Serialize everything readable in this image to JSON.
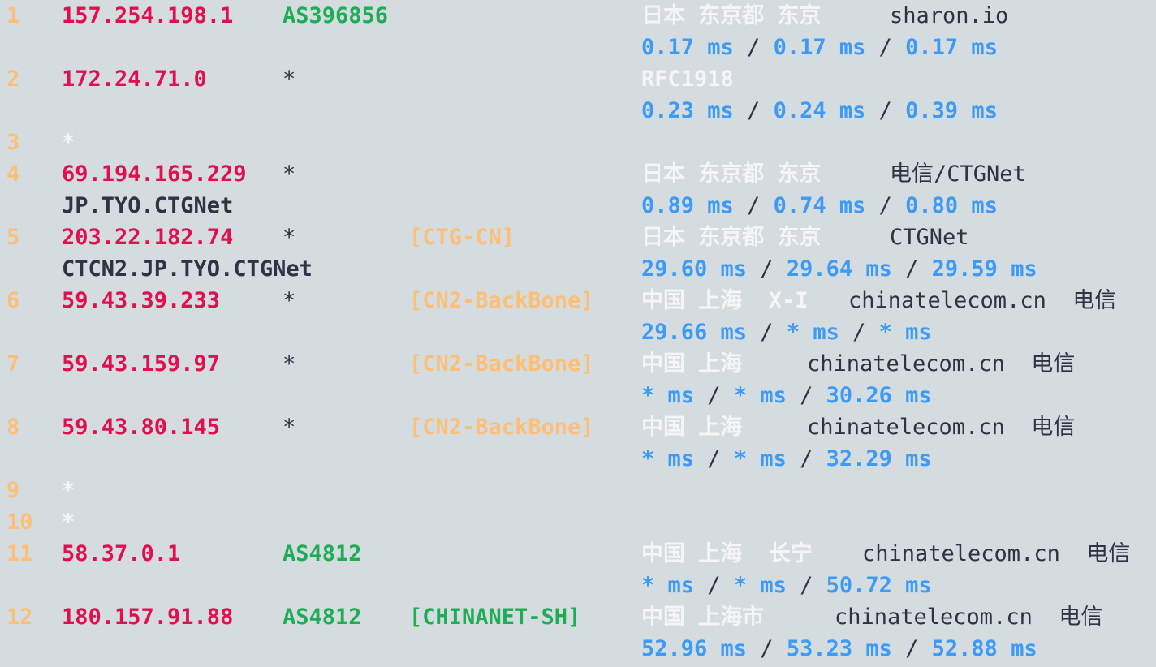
{
  "colors": {
    "background": "#d5dce0",
    "hop_number": "#fdbe76",
    "ip": "#e0104e",
    "asn": "#1eac55",
    "tag_orange": "#fdbe76",
    "geo": "#f5f5f5",
    "text": "#2d3445",
    "latency": "#3d9af5"
  },
  "hops": [
    {
      "num": "1",
      "ip": "157.254.198.1",
      "asn": "AS396856",
      "tag": "",
      "geo": "日本 东京都 东京",
      "org": "sharon.io",
      "host": "",
      "latency": [
        "0.17 ms",
        "0.17 ms",
        "0.17 ms"
      ]
    },
    {
      "num": "2",
      "ip": "172.24.71.0",
      "asn": "*",
      "tag": "",
      "geo": "RFC1918",
      "org": "",
      "host": "",
      "latency": [
        "0.23 ms",
        "0.24 ms",
        "0.39 ms"
      ]
    },
    {
      "num": "3",
      "star": "*"
    },
    {
      "num": "4",
      "ip": "69.194.165.229",
      "asn": "*",
      "tag": "",
      "geo": "日本 东京都 东京",
      "org": "电信/CTGNet",
      "host": "JP.TYO.CTGNet",
      "latency": [
        "0.89 ms",
        "0.74 ms",
        "0.80 ms"
      ]
    },
    {
      "num": "5",
      "ip": "203.22.182.74",
      "asn": "*",
      "tag": "[CTG-CN]",
      "geo": "日本 东京都 东京",
      "org": "CTGNet",
      "host": "CTCN2.JP.TYO.CTGNet",
      "latency": [
        "29.60 ms",
        "29.64 ms",
        "29.59 ms"
      ]
    },
    {
      "num": "6",
      "ip": "59.43.39.233",
      "asn": "*",
      "tag": "[CN2-BackBone]",
      "geo": "中国 上海  X-I",
      "org": "chinatelecom.cn  电信",
      "host": "",
      "latency": [
        "29.66 ms",
        "* ms",
        "* ms"
      ]
    },
    {
      "num": "7",
      "ip": "59.43.159.97",
      "asn": "*",
      "tag": "[CN2-BackBone]",
      "geo": "中国 上海",
      "org": "chinatelecom.cn  电信",
      "host": "",
      "latency": [
        "* ms",
        "* ms",
        "30.26 ms"
      ]
    },
    {
      "num": "8",
      "ip": "59.43.80.145",
      "asn": "*",
      "tag": "[CN2-BackBone]",
      "geo": "中国 上海",
      "org": "chinatelecom.cn  电信",
      "host": "",
      "latency": [
        "* ms",
        "* ms",
        "32.29 ms"
      ]
    },
    {
      "num": "9",
      "star": "*"
    },
    {
      "num": "10",
      "star": "*"
    },
    {
      "num": "11",
      "ip": "58.37.0.1",
      "asn": "AS4812",
      "tag": "",
      "geo": "中国 上海  长宁",
      "org": "chinatelecom.cn  电信",
      "host": "",
      "latency": [
        "* ms",
        "* ms",
        "50.72 ms"
      ]
    },
    {
      "num": "12",
      "ip": "180.157.91.88",
      "asn": "AS4812",
      "tag": "[CHINANET-SH]",
      "geo": "中国 上海市",
      "org": "chinatelecom.cn  电信",
      "host": "",
      "latency": [
        "52.96 ms",
        "53.23 ms",
        "52.88 ms"
      ]
    }
  ],
  "latency_sep": " / "
}
